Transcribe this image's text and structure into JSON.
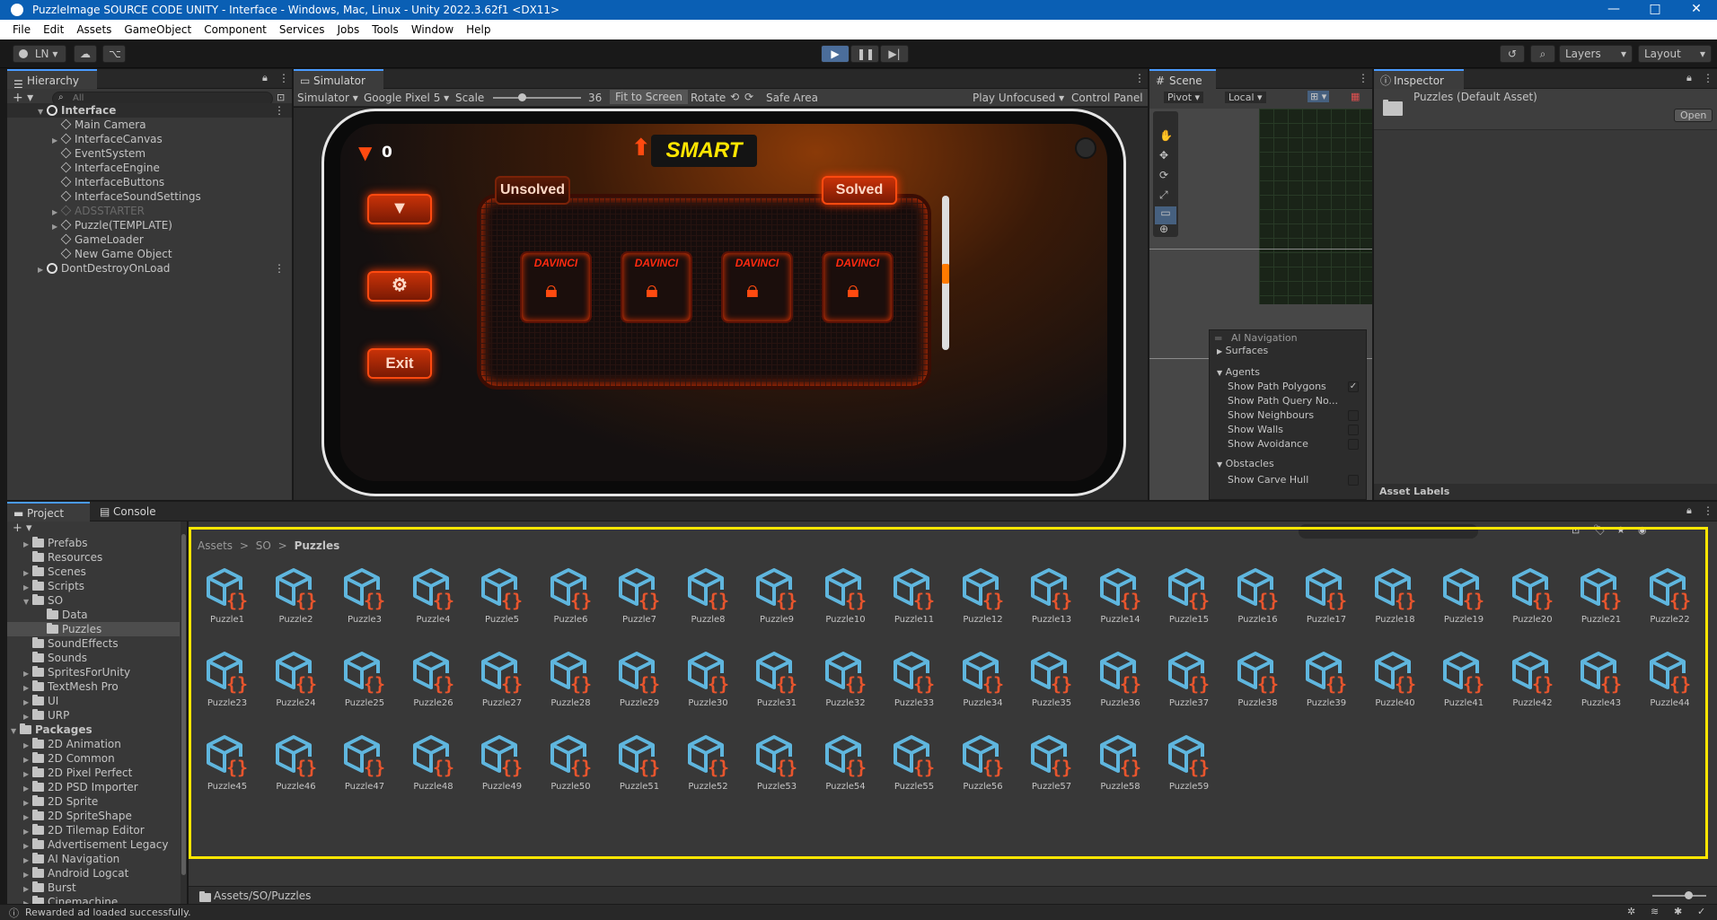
{
  "window": {
    "title": "PuzzleImage SOURCE CODE UNITY - Interface - Windows, Mac, Linux - Unity 2022.3.62f1 <DX11>"
  },
  "menu": [
    "File",
    "Edit",
    "Assets",
    "GameObject",
    "Component",
    "Services",
    "Jobs",
    "Tools",
    "Window",
    "Help"
  ],
  "toolbar": {
    "account": "LN",
    "layers": "Layers",
    "layout": "Layout"
  },
  "hierarchy": {
    "tab": "Hierarchy",
    "search_placeholder": "All",
    "scene": "Interface",
    "items": [
      "Main Camera",
      "InterfaceCanvas",
      "EventSystem",
      "InterfaceEngine",
      "InterfaceButtons",
      "InterfaceSoundSettings",
      "ADSSTARTER",
      "Puzzle(TEMPLATE)",
      "GameLoader",
      "New Game Object"
    ],
    "dont_destroy": "DontDestroyOnLoad"
  },
  "simulator": {
    "tab": "Simulator",
    "mode": "Simulator",
    "device": "Google Pixel 5",
    "scale_label": "Scale",
    "scale_value": "36",
    "fit": "Fit to Screen",
    "rotate": "Rotate",
    "safe_area": "Safe Area",
    "play_mode": "Play Unfocused",
    "control_panel": "Control Panel"
  },
  "game": {
    "gems": "0",
    "mode_title": "SMART",
    "tab_unsolved": "Unsolved",
    "tab_solved": "Solved",
    "exit": "Exit",
    "card_label": "DAVINCI"
  },
  "scene": {
    "tab": "Scene",
    "pivot": "Pivot",
    "local": "Local",
    "overlay_title": "AI Navigation",
    "surfaces": "Surfaces",
    "agents": "Agents",
    "agent_items": [
      "Show Path Polygons",
      "Show Path Query No...",
      "Show Neighbours",
      "Show Walls",
      "Show Avoidance"
    ],
    "obstacles": "Obstacles",
    "obstacle_items": [
      "Show Carve Hull"
    ]
  },
  "inspector": {
    "tab": "Inspector",
    "asset": "Puzzles (Default Asset)",
    "open": "Open",
    "asset_labels": "Asset Labels"
  },
  "project": {
    "tab_project": "Project",
    "tab_console": "Console",
    "tree": [
      "Prefabs",
      "Resources",
      "Scenes",
      "Scripts",
      "SO",
      "Data",
      "Puzzles",
      "SoundEffects",
      "Sounds",
      "SpritesForUnity",
      "TextMesh Pro",
      "UI",
      "URP"
    ],
    "packages_label": "Packages",
    "packages": [
      "2D Animation",
      "2D Common",
      "2D Pixel Perfect",
      "2D PSD Importer",
      "2D Sprite",
      "2D SpriteShape",
      "2D Tilemap Editor",
      "Advertisement Legacy",
      "AI Navigation",
      "Android Logcat",
      "Burst",
      "Cinemachine"
    ],
    "breadcrumb": [
      "Assets",
      "SO",
      "Puzzles"
    ],
    "assets": [
      "Puzzle1",
      "Puzzle2",
      "Puzzle3",
      "Puzzle4",
      "Puzzle5",
      "Puzzle6",
      "Puzzle7",
      "Puzzle8",
      "Puzzle9",
      "Puzzle10",
      "Puzzle11",
      "Puzzle12",
      "Puzzle13",
      "Puzzle14",
      "Puzzle15",
      "Puzzle16",
      "Puzzle17",
      "Puzzle18",
      "Puzzle19",
      "Puzzle20",
      "Puzzle21",
      "Puzzle22",
      "Puzzle23",
      "Puzzle24",
      "Puzzle25",
      "Puzzle26",
      "Puzzle27",
      "Puzzle28",
      "Puzzle29",
      "Puzzle30",
      "Puzzle31",
      "Puzzle32",
      "Puzzle33",
      "Puzzle34",
      "Puzzle35",
      "Puzzle36",
      "Puzzle37",
      "Puzzle38",
      "Puzzle39",
      "Puzzle40",
      "Puzzle41",
      "Puzzle42",
      "Puzzle43",
      "Puzzle44",
      "Puzzle45",
      "Puzzle46",
      "Puzzle47",
      "Puzzle48",
      "Puzzle49",
      "Puzzle50",
      "Puzzle51",
      "Puzzle52",
      "Puzzle53",
      "Puzzle54",
      "Puzzle55",
      "Puzzle56",
      "Puzzle57",
      "Puzzle58",
      "Puzzle59"
    ],
    "footer_path": "Assets/SO/Puzzles"
  },
  "status": {
    "message": "Rewarded ad loaded successfully."
  },
  "colors": {
    "accent": "#4a9bff",
    "highlight": "#ffe600",
    "neon": "#ff4a10",
    "so_icon_blue": "#5fb6de",
    "so_icon_orange": "#e8552d"
  }
}
